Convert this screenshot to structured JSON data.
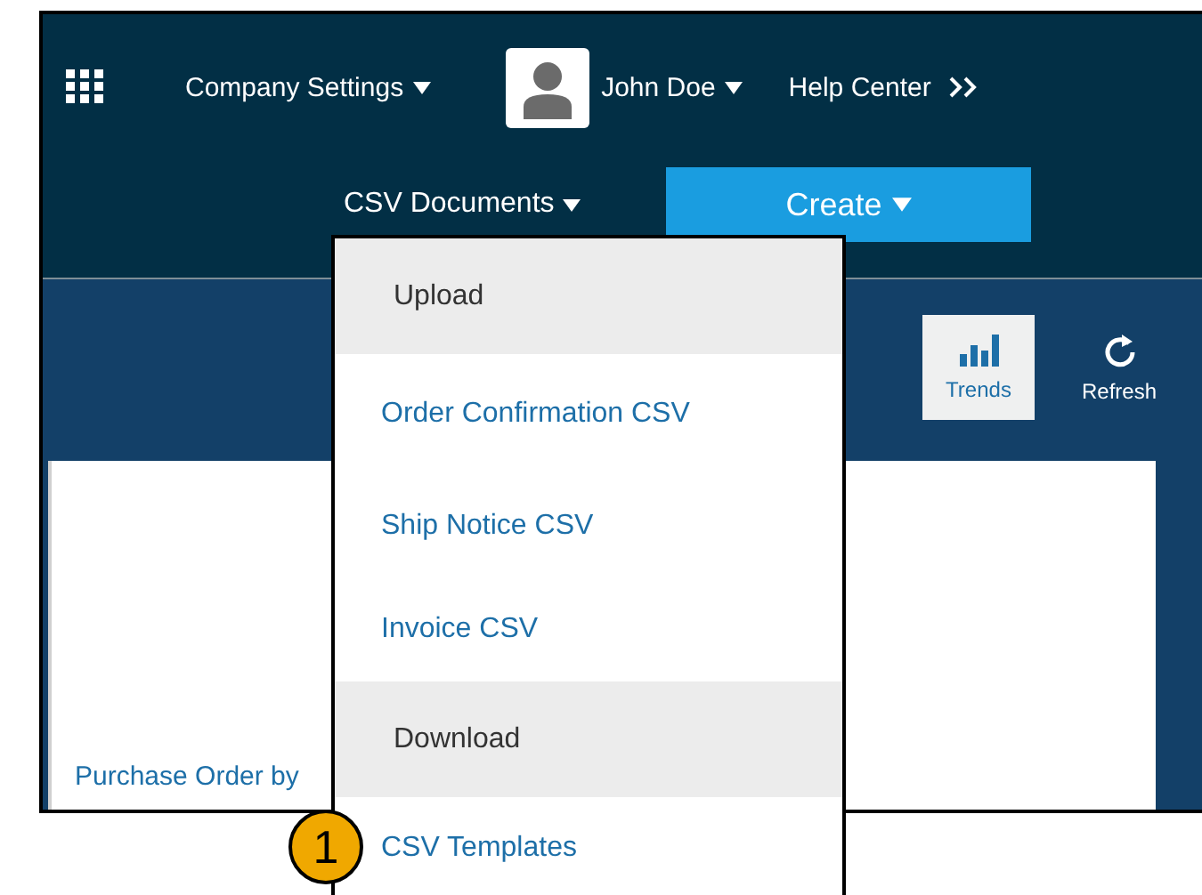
{
  "top_bar": {
    "company_menu": "Company Settings",
    "user_menu": "John Doe",
    "help_link": "Help Center"
  },
  "nav": {
    "csv_menu": "CSV Documents",
    "create_button": "Create"
  },
  "toolbar": [
    {
      "label": "Trends",
      "kind": "trends",
      "selected": true
    },
    {
      "label": "Refresh",
      "kind": "refresh",
      "selected": false
    }
  ],
  "content": {
    "link": "Purchase Order by"
  },
  "dropdown": [
    {
      "label": "Upload",
      "kind": "header"
    },
    {
      "label": "Order Confirmation CSV",
      "kind": "link"
    },
    {
      "label": "Ship Notice CSV",
      "kind": "link"
    },
    {
      "label": "Invoice CSV",
      "kind": "link"
    },
    {
      "label": "Download",
      "kind": "header"
    },
    {
      "label": "CSV Templates",
      "kind": "link"
    }
  ],
  "callout": "1"
}
